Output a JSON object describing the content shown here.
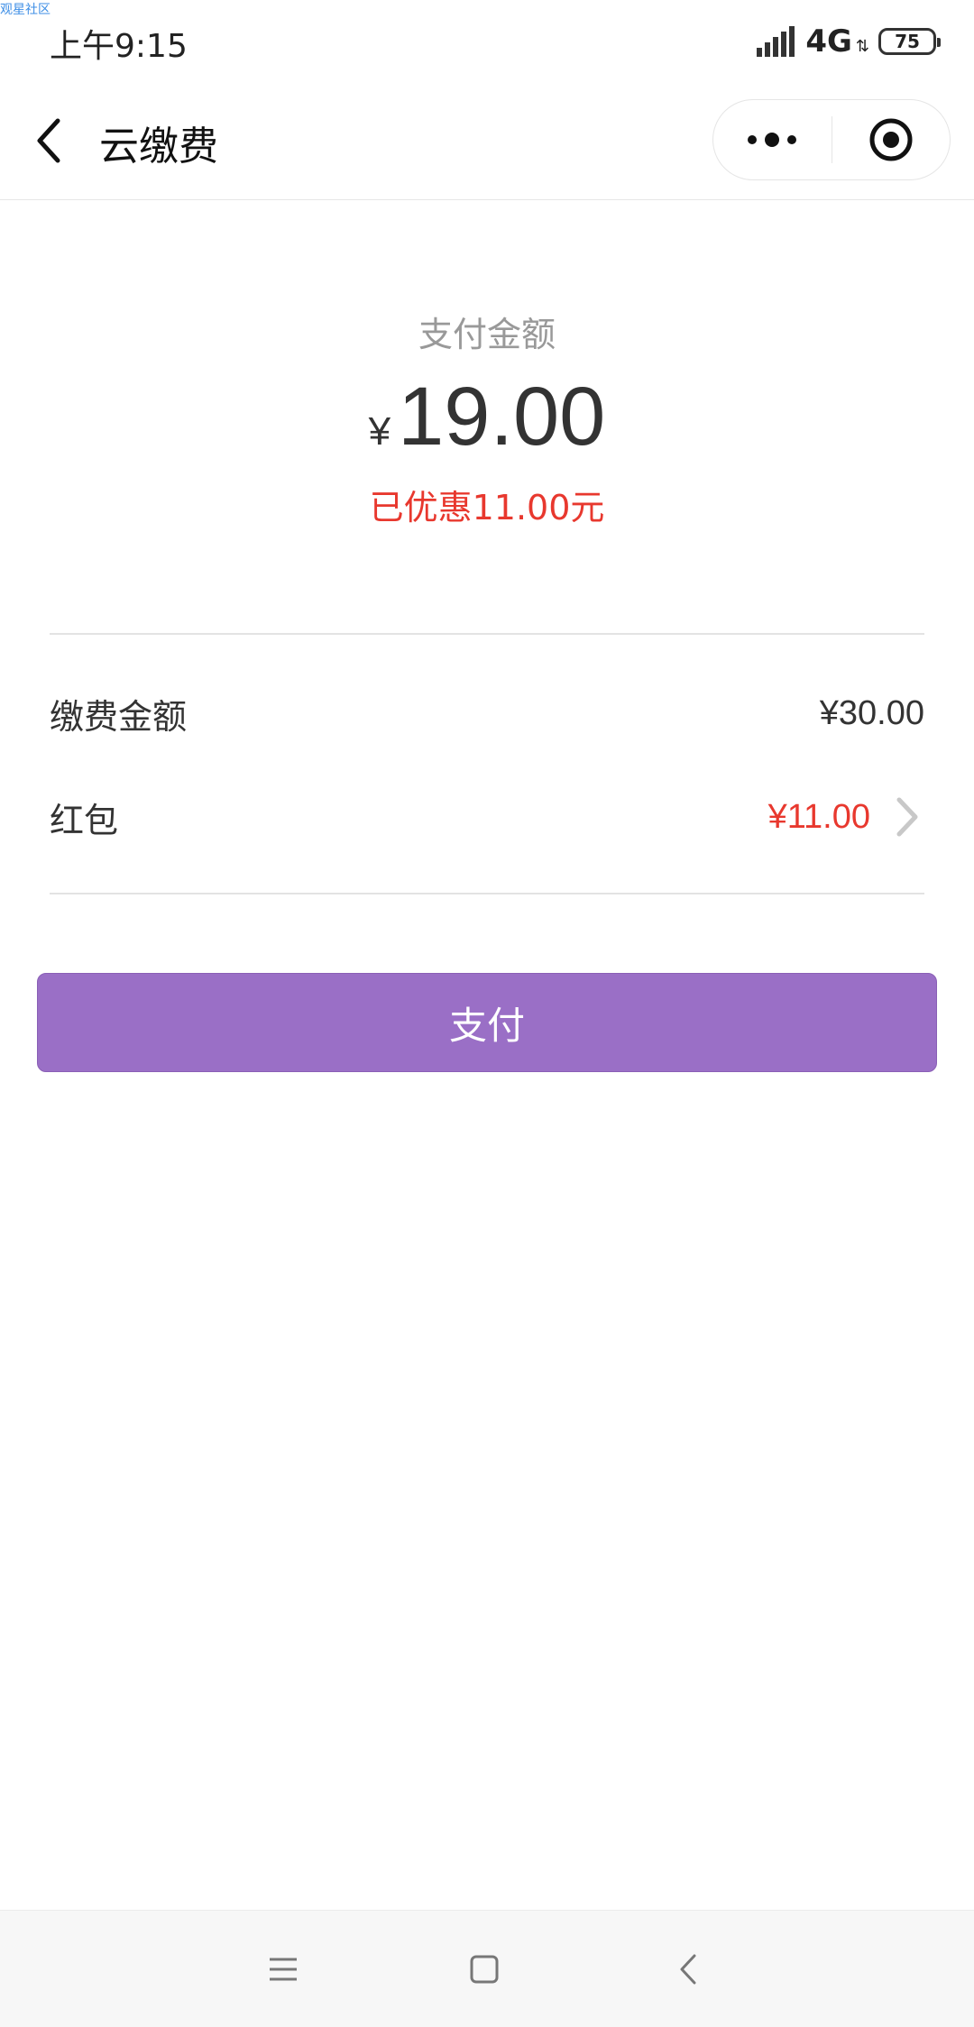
{
  "watermark": "观星社区",
  "status_bar": {
    "time": "上午9:15",
    "network": "4G",
    "battery": "75"
  },
  "nav": {
    "title": "云缴费"
  },
  "payment": {
    "label": "支付金额",
    "currency": "¥",
    "amount": "19.00",
    "discount_note": "已优惠11.00元"
  },
  "details": [
    {
      "label": "缴费金额",
      "value": "¥30.00"
    },
    {
      "label": "红包",
      "value": "¥11.00"
    }
  ],
  "pay_button": {
    "label": "支付"
  },
  "colors": {
    "accent": "#9a6fc6",
    "discount_red": "#e8382e",
    "label_gray": "#999999"
  },
  "icons": {
    "nav_back": "chevron-left-icon",
    "menu": "more-dots-icon",
    "close_app": "target-circle-icon",
    "bottom_menu": "hamburger-icon",
    "bottom_home": "square-icon",
    "bottom_back": "chevron-left-icon"
  }
}
